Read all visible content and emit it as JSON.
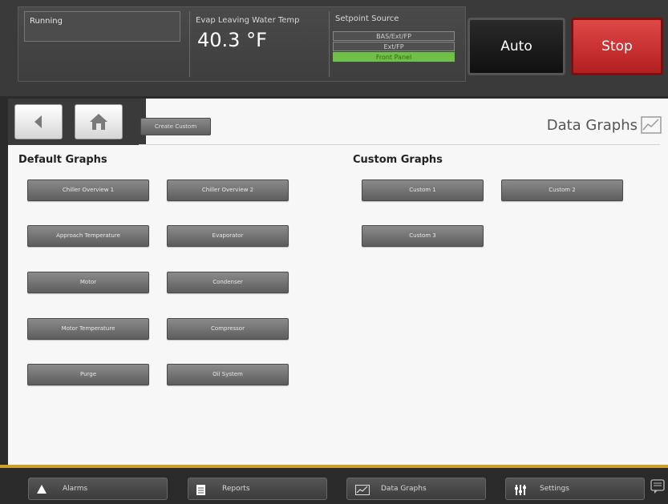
{
  "status": {
    "text": "Running"
  },
  "evap": {
    "label": "Evap Leaving Water Temp",
    "value": "40.3 °F"
  },
  "setpoint_source": {
    "label": "Setpoint Source",
    "options": [
      "BAS/Ext/FP",
      "Ext/FP",
      "Front Panel"
    ],
    "selected": "Front Panel"
  },
  "controls": {
    "auto": "Auto",
    "stop": "Stop"
  },
  "page": {
    "title": "Data Graphs",
    "create_custom": "Create Custom"
  },
  "default_graphs": {
    "title": "Default Graphs",
    "buttons": [
      "Chiller Overview 1",
      "Chiller Overview 2",
      "Approach Temperature",
      "Evaporator",
      "Motor",
      "Condenser",
      "Motor Temperature",
      "Compressor",
      "Purge",
      "Oil System"
    ]
  },
  "custom_graphs": {
    "title": "Custom Graphs",
    "buttons": [
      "Custom 1",
      "Custom 2",
      "Custom 3"
    ]
  },
  "bottom_nav": [
    "Alarms",
    "Reports",
    "Data Graphs",
    "Settings"
  ],
  "colors": {
    "stop": "#c62828",
    "front_panel": "#6fc046",
    "accent_line": "#c9a227"
  }
}
